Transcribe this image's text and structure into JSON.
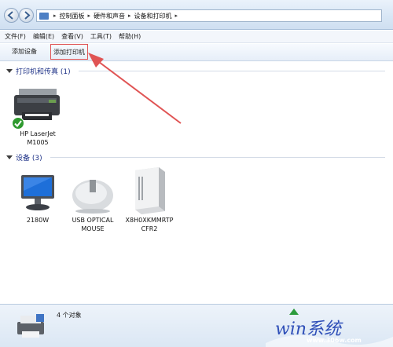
{
  "breadcrumb": [
    "控制面板",
    "硬件和声音",
    "设备和打印机"
  ],
  "menu": [
    "文件(F)",
    "编辑(E)",
    "查看(V)",
    "工具(T)",
    "帮助(H)"
  ],
  "toolbar": {
    "add_device": "添加设备",
    "add_printer": "添加打印机"
  },
  "printers_group": {
    "title": "打印机和传真 (1)",
    "items": [
      {
        "name": "HP LaserJet\nM1005",
        "line1": "HP LaserJet",
        "line2": "M1005",
        "default": true
      }
    ]
  },
  "devices_group": {
    "title": "设备 (3)",
    "items": [
      {
        "line1": "2180W",
        "line2": ""
      },
      {
        "line1": "USB OPTICAL",
        "line2": "MOUSE"
      },
      {
        "line1": "X8H0XKMMRTP",
        "line2": "CFR2"
      }
    ]
  },
  "status": {
    "count": "4 个对象"
  },
  "watermark": {
    "text": "win系统",
    "site": "www.306w.com"
  },
  "colors": {
    "annotation_red": "#e05454",
    "group_title": "#1e3287"
  }
}
